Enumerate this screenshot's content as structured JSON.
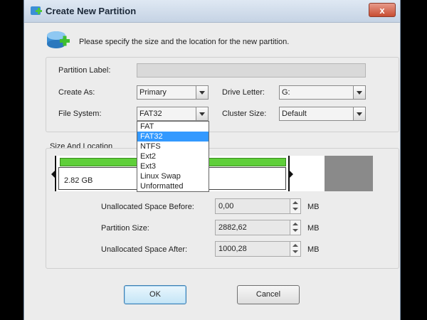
{
  "window": {
    "title": "Create New Partition",
    "close_label": "x"
  },
  "header": {
    "text": "Please specify the size and the location for the new partition."
  },
  "form": {
    "partition_label": {
      "label": "Partition Label:",
      "value": ""
    },
    "create_as": {
      "label": "Create As:",
      "value": "Primary"
    },
    "drive_letter": {
      "label": "Drive Letter:",
      "value": "G:"
    },
    "file_system": {
      "label": "File System:",
      "value": "FAT32"
    },
    "cluster_size": {
      "label": "Cluster Size:",
      "value": "Default"
    }
  },
  "file_system_options": [
    "FAT",
    "FAT32",
    "NTFS",
    "Ext2",
    "Ext3",
    "Linux Swap",
    "Unformatted"
  ],
  "file_system_selected_index": 1,
  "size_location": {
    "label": "Size And Location",
    "bar_size_text": "2.82 GB",
    "unallocated_before": {
      "label": "Unallocated Space Before:",
      "value": "0,00",
      "unit": "MB"
    },
    "partition_size": {
      "label": "Partition Size:",
      "value": "2882,62",
      "unit": "MB"
    },
    "unallocated_after": {
      "label": "Unallocated Space After:",
      "value": "1000,28",
      "unit": "MB"
    }
  },
  "buttons": {
    "ok": "OK",
    "cancel": "Cancel"
  },
  "colors": {
    "partition_fill": "#5fcf3a",
    "unallocated": "#8a8a8a",
    "selection": "#3399ff"
  }
}
